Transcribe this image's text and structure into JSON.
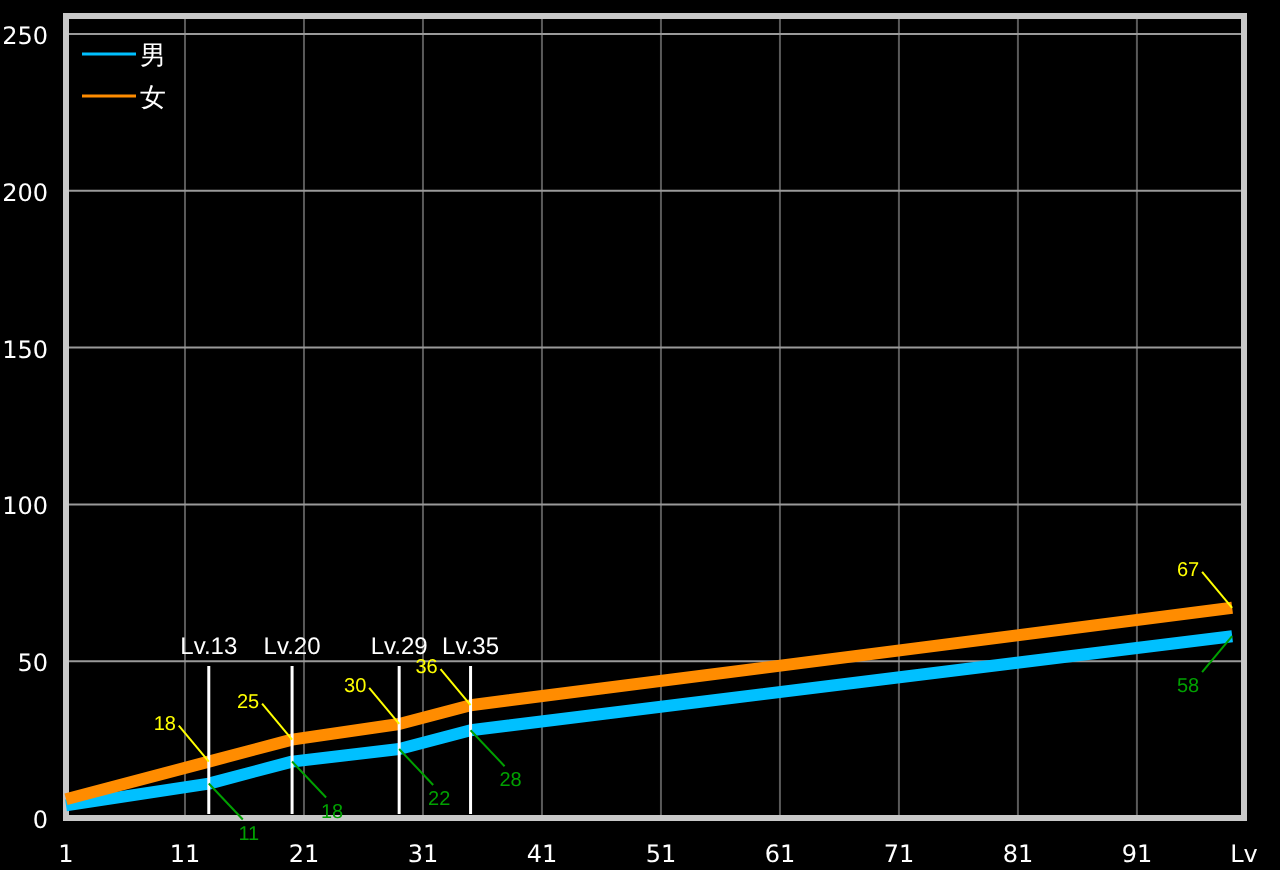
{
  "chart": {
    "chart_data": {
      "type": "line",
      "xlabel": "Lv",
      "x": [
        1,
        13,
        20,
        29,
        35,
        99
      ],
      "series": [
        {
          "name": "男",
          "color": "#00c0ff",
          "values": [
            4,
            11,
            18,
            22,
            28,
            58
          ]
        },
        {
          "name": "女",
          "color": "#ff8c00",
          "values": [
            6,
            18,
            25,
            30,
            36,
            67
          ]
        }
      ],
      "xlim": [
        1,
        100
      ],
      "ylim": [
        0,
        250
      ],
      "xticks": [
        1,
        11,
        21,
        31,
        41,
        51,
        61,
        71,
        81,
        91
      ],
      "yticks": [
        0,
        50,
        100,
        150,
        200,
        250
      ],
      "grid": true,
      "legend": "upper left",
      "annotations": [
        {
          "x": 13,
          "text": "Lv.13"
        },
        {
          "x": 20,
          "text": "Lv.20"
        },
        {
          "x": 29,
          "text": "Lv.29"
        },
        {
          "x": 35,
          "text": "Lv.35"
        },
        {
          "x": 13,
          "y": 18,
          "text": "18"
        },
        {
          "x": 20,
          "y": 25,
          "text": "25"
        },
        {
          "x": 29,
          "y": 30,
          "text": "30"
        },
        {
          "x": 35,
          "y": 36,
          "text": "36"
        },
        {
          "x": 99,
          "y": 67,
          "text": "67"
        },
        {
          "x": 13,
          "y": 11,
          "text": "11"
        },
        {
          "x": 20,
          "y": 18,
          "text": "18"
        },
        {
          "x": 29,
          "y": 22,
          "text": "22"
        },
        {
          "x": 35,
          "y": 28,
          "text": "28"
        },
        {
          "x": 99,
          "y": 58,
          "text": "58"
        }
      ]
    }
  }
}
